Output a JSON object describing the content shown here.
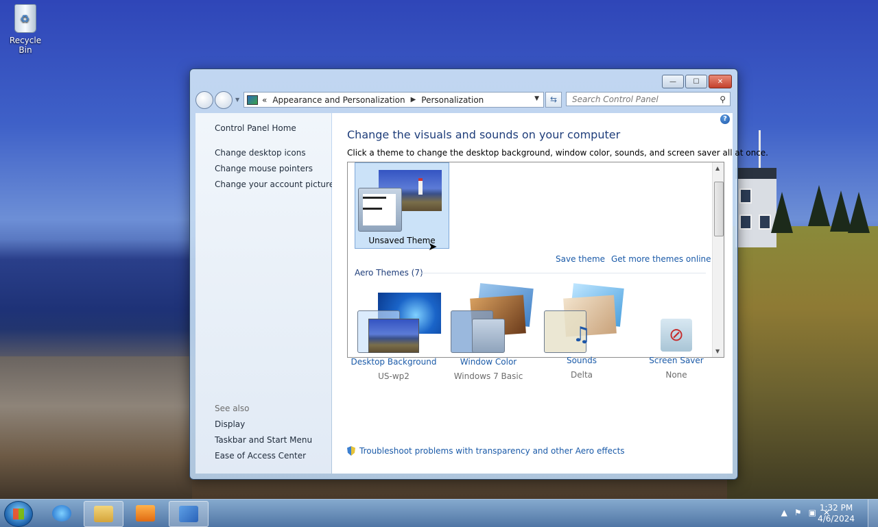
{
  "desktop": {
    "recycle_bin_label": "Recycle Bin"
  },
  "window": {
    "address": {
      "chevron": "«",
      "crumb1": "Appearance and Personalization",
      "crumb2": "Personalization"
    },
    "search_placeholder": "Search Control Panel",
    "caption": {
      "minimize": "—",
      "maximize": "☐",
      "close": "✕"
    }
  },
  "sidebar": {
    "home": "Control Panel Home",
    "links": [
      "Change desktop icons",
      "Change mouse pointers",
      "Change your account picture"
    ],
    "see_also_label": "See also",
    "see_also": [
      "Display",
      "Taskbar and Start Menu",
      "Ease of Access Center"
    ]
  },
  "main": {
    "title": "Change the visuals and sounds on your computer",
    "subtitle": "Click a theme to change the desktop background, window color, sounds, and screen saver all at once.",
    "unsaved_theme": "Unsaved Theme",
    "save_theme": "Save theme",
    "get_more": "Get more themes online",
    "aero_header": "Aero Themes (7)",
    "bottom": [
      {
        "label": "Desktop Background",
        "value": "US-wp2"
      },
      {
        "label": "Window Color",
        "value": "Windows 7 Basic"
      },
      {
        "label": "Sounds",
        "value": "Delta"
      },
      {
        "label": "Screen Saver",
        "value": "None"
      }
    ],
    "troubleshoot": "Troubleshoot problems with transparency and other Aero effects"
  },
  "taskbar": {
    "time": "1:32 PM",
    "date": "4/6/2024"
  },
  "colors": {
    "link": "#1a5aa8",
    "heading": "#1e3d7a"
  }
}
